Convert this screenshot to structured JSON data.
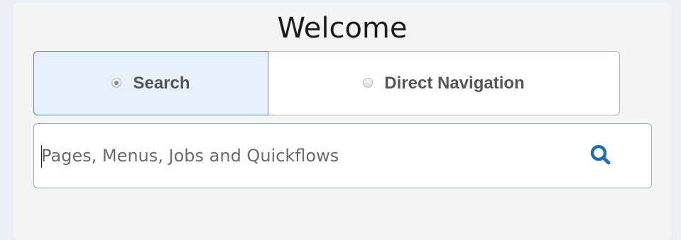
{
  "title": "Welcome",
  "mode_toggle": {
    "options": [
      {
        "label": "Search",
        "selected": true
      },
      {
        "label": "Direct Navigation",
        "selected": false
      }
    ]
  },
  "search": {
    "value": "",
    "placeholder": "Pages, Menus, Jobs and Quickflows",
    "icon": "search-icon"
  },
  "colors": {
    "accent": "#1f6fb5",
    "selected_bg": "#e8f1fb",
    "card_bg": "#f4f4f4"
  }
}
